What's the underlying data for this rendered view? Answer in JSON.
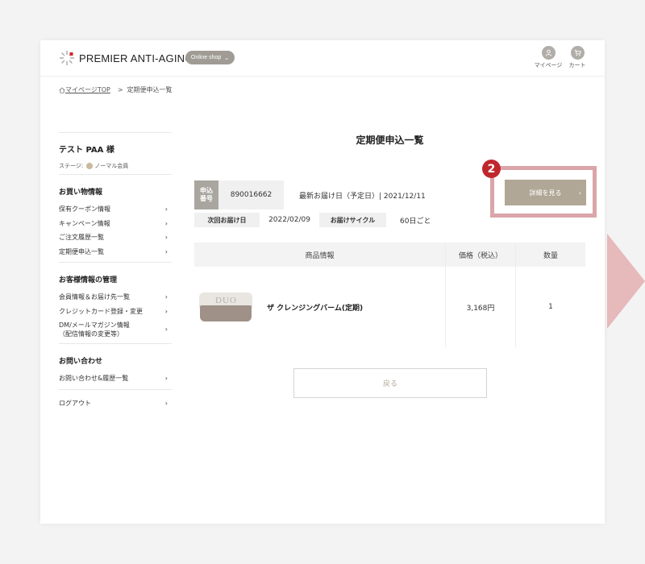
{
  "header": {
    "logo_text": "PREMIER ANTI-AGING",
    "shop_label": "Online shop",
    "mypage_label": "マイページ",
    "cart_label": "カート"
  },
  "breadcrumb": {
    "home": "マイページTOP",
    "separator": ">",
    "current": "定期便申込一覧"
  },
  "sidebar": {
    "user_name": "テスト PAA 様",
    "stage_label": "ステージ:",
    "stage_value": "ノーマル会員",
    "sections": [
      {
        "title": "お買い物情報",
        "items": [
          "保有クーポン情報",
          "キャンペーン情報",
          "ご注文履歴一覧",
          "定期便申込一覧"
        ]
      },
      {
        "title": "お客様情報の管理",
        "items": [
          "会員情報＆お届け先一覧",
          "クレジットカード登録・変更"
        ],
        "multi_line_item": [
          "DM/メールマガジン情報",
          "（配信情報の変更等）"
        ]
      },
      {
        "title": "お問い合わせ",
        "items": [
          "お問い合わせ&履歴一覧"
        ]
      }
    ],
    "logout": "ログアウト",
    "arrow": "›"
  },
  "main": {
    "title": "定期便申込一覧",
    "order": {
      "label_line1": "申込",
      "label_line2": "番号",
      "number": "890016662",
      "latest_delivery": "最新お届け日（予定日）| 2021/12/11",
      "detail_button": "詳細を見る",
      "next_delivery_label": "次回お届け日",
      "next_delivery_date": "2022/02/09",
      "cycle_label": "お届けサイクル",
      "cycle_value": "60日ごと"
    },
    "table": {
      "headers": [
        "商品情報",
        "価格（税込）",
        "数量"
      ],
      "rows": [
        {
          "product_name": "ザ クレンジングバーム(定期)",
          "price": "3,168円",
          "quantity": "1",
          "image_brand": "DUO"
        }
      ]
    },
    "back_button": "戻る",
    "step_badge": "2"
  },
  "colors": {
    "accent_button": "#b1a796",
    "highlight": "#dba5a9",
    "badge": "#c0272d",
    "label_gray": "#a9a6a0"
  }
}
